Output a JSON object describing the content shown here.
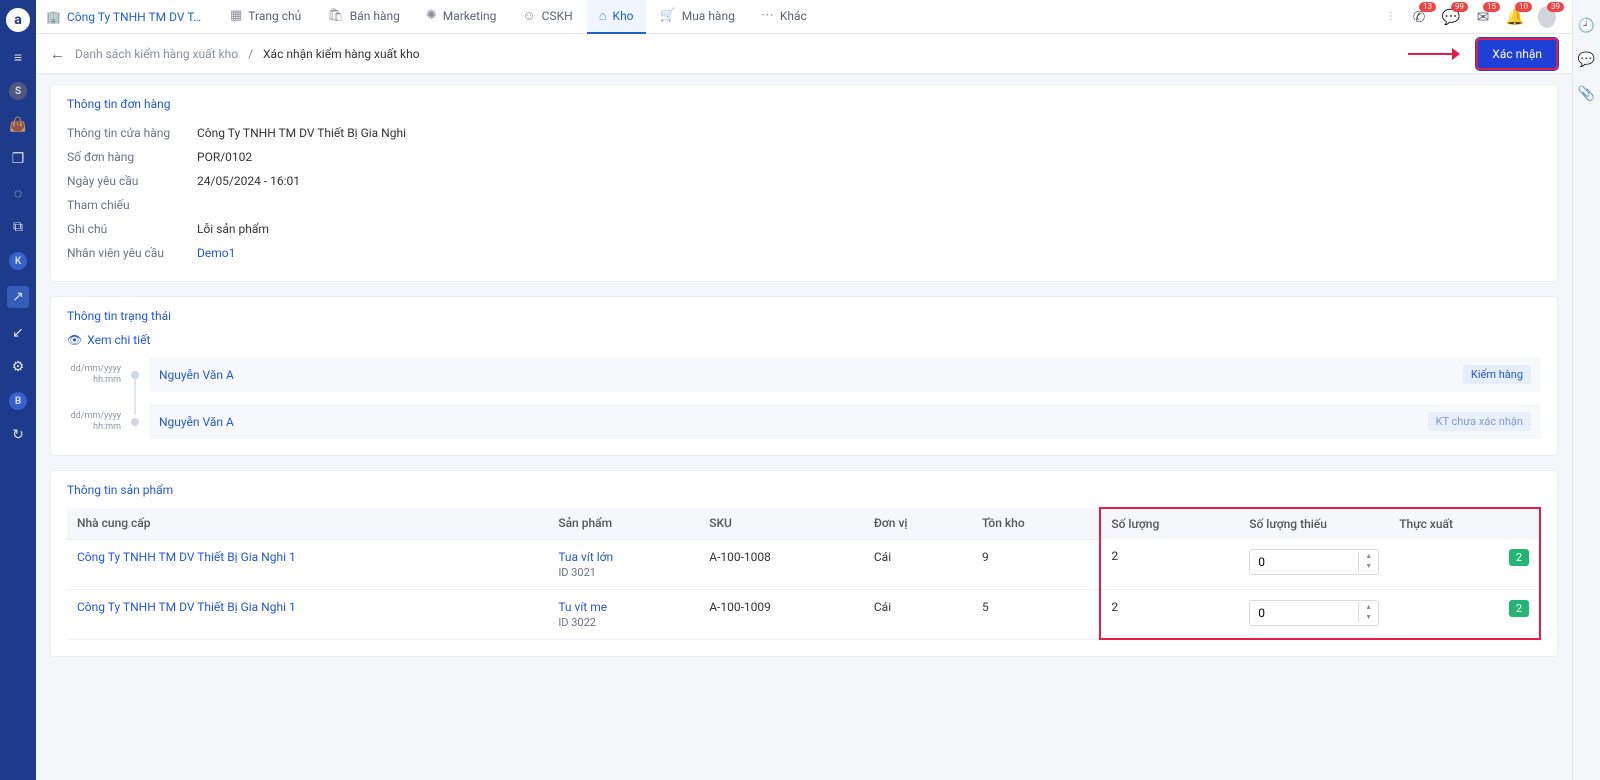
{
  "org_name": "Công Ty TNHH TM DV T…",
  "tabs": [
    {
      "label": "Trang chủ"
    },
    {
      "label": "Bán hàng"
    },
    {
      "label": "Marketing"
    },
    {
      "label": "CSKH"
    },
    {
      "label": "Kho"
    },
    {
      "label": "Mua hàng"
    },
    {
      "label": "Khác"
    }
  ],
  "top_badges": {
    "phone": "13",
    "chat": "99",
    "mail": "15",
    "bell": "10",
    "avatar": "39"
  },
  "breadcrumb": {
    "prev": "Danh sách kiểm hàng xuất kho",
    "current": "Xác nhận kiểm hàng xuất kho"
  },
  "confirm_label": "Xác nhận",
  "order_section": {
    "title": "Thông tin đơn hàng",
    "rows": {
      "store_k": "Thông tin cửa hàng",
      "store_v": "Công Ty TNHH TM DV Thiết Bị Gia Nghi",
      "code_k": "Số đơn hàng",
      "code_v": "POR/0102",
      "date_k": "Ngày yêu cầu",
      "date_v": "24/05/2024 - 16:01",
      "ref_k": "Tham chiếu",
      "ref_v": "",
      "note_k": "Ghi chú",
      "note_v": "Lỗi sản phẩm",
      "staff_k": "Nhân viên yêu cầu",
      "staff_v": "Demo1"
    }
  },
  "status_section": {
    "title": "Thông tin trạng thái",
    "view_detail": "Xem chi tiết",
    "date_ph": "dd/mm/yyyy\nhh:mm",
    "items": [
      {
        "name": "Nguyễn Văn A",
        "badge": "Kiểm hàng",
        "cls": "b1"
      },
      {
        "name": "Nguyễn Văn A",
        "badge": "KT chưa xác nhận",
        "cls": "b2"
      }
    ]
  },
  "product_section": {
    "title": "Thông tin sản phẩm",
    "headers": {
      "supplier": "Nhà cung cấp",
      "product": "Sản phẩm",
      "sku": "SKU",
      "unit": "Đơn vị",
      "stock": "Tồn kho",
      "qty": "Số lượng",
      "missing": "Số lượng thiếu",
      "actual": "Thực xuất"
    },
    "rows": [
      {
        "supplier": "Công Ty TNHH TM DV Thiết Bị Gia Nghi 1",
        "name": "Tua vít lớn",
        "id": "ID 3021",
        "sku": "A-100-1008",
        "unit": "Cái",
        "stock": "9",
        "qty": "2",
        "missing": "0",
        "actual": "2"
      },
      {
        "supplier": "Công Ty TNHH TM DV Thiết Bị Gia Nghi 1",
        "name": "Tu vít me",
        "id": "ID 3022",
        "sku": "A-100-1009",
        "unit": "Cái",
        "stock": "5",
        "qty": "2",
        "missing": "0",
        "actual": "2"
      }
    ]
  }
}
